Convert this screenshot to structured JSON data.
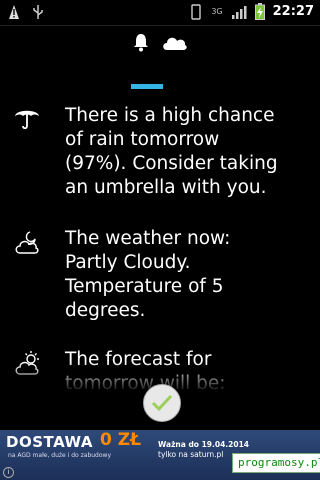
{
  "status_bar": {
    "network_type": "3G",
    "time": "22:27"
  },
  "header": {
    "icons": [
      "bell-icon",
      "cloud-icon"
    ]
  },
  "forecast_items": [
    {
      "icon": "umbrella-icon",
      "text": "There is a high chance\nof rain tomorrow\n(97%). Consider taking\nan umbrella with you."
    },
    {
      "icon": "partly-cloudy-night-icon",
      "text": "The weather now:\nPartly Cloudy.\nTemperature of 5\ndegrees."
    },
    {
      "icon": "partly-cloudy-day-icon",
      "text": "The forecast for\ntomorrow will be:"
    }
  ],
  "ad": {
    "brand": "DOSTAWA",
    "price": "0 ZŁ",
    "subtitle": "na AGD małe, duże i do zabudowy",
    "validity": "Ważna do 19.04.2014",
    "site": "tylko na saturn.pl",
    "store": "SATURN"
  },
  "watermark": "programosy.pl",
  "colors": {
    "accent": "#33b5e5",
    "background": "#000000"
  }
}
